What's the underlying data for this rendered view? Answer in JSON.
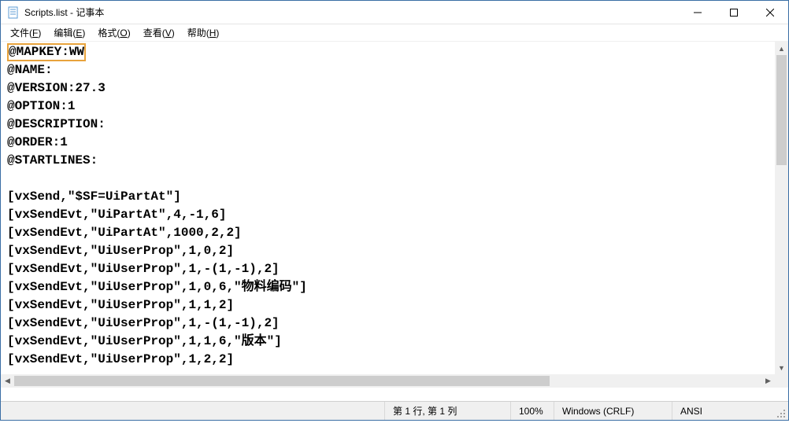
{
  "window": {
    "title": "Scripts.list - 记事本"
  },
  "menu": {
    "file": "文件(F)",
    "edit": "编辑(E)",
    "format": "格式(O)",
    "view": "查看(V)",
    "help": "帮助(H)"
  },
  "editor": {
    "highlighted_line": "@MAPKEY:WW",
    "lines": [
      "@NAME:",
      "@VERSION:27.3",
      "@OPTION:1",
      "@DESCRIPTION:",
      "@ORDER:1",
      "@STARTLINES:",
      "",
      "[vxSend,\"$SF=UiPartAt\"]",
      "[vxSendEvt,\"UiPartAt\",4,-1,6]",
      "[vxSendEvt,\"UiPartAt\",1000,2,2]",
      "[vxSendEvt,\"UiUserProp\",1,0,2]",
      "[vxSendEvt,\"UiUserProp\",1,-(1,-1),2]",
      "[vxSendEvt,\"UiUserProp\",1,0,6,\"物料编码\"]",
      "[vxSendEvt,\"UiUserProp\",1,1,2]",
      "[vxSendEvt,\"UiUserProp\",1,-(1,-1),2]",
      "[vxSendEvt,\"UiUserProp\",1,1,6,\"版本\"]",
      "[vxSendEvt,\"UiUserProp\",1,2,2]"
    ]
  },
  "status": {
    "position": "第 1 行, 第 1 列",
    "zoom": "100%",
    "line_ending": "Windows (CRLF)",
    "encoding": "ANSI"
  }
}
